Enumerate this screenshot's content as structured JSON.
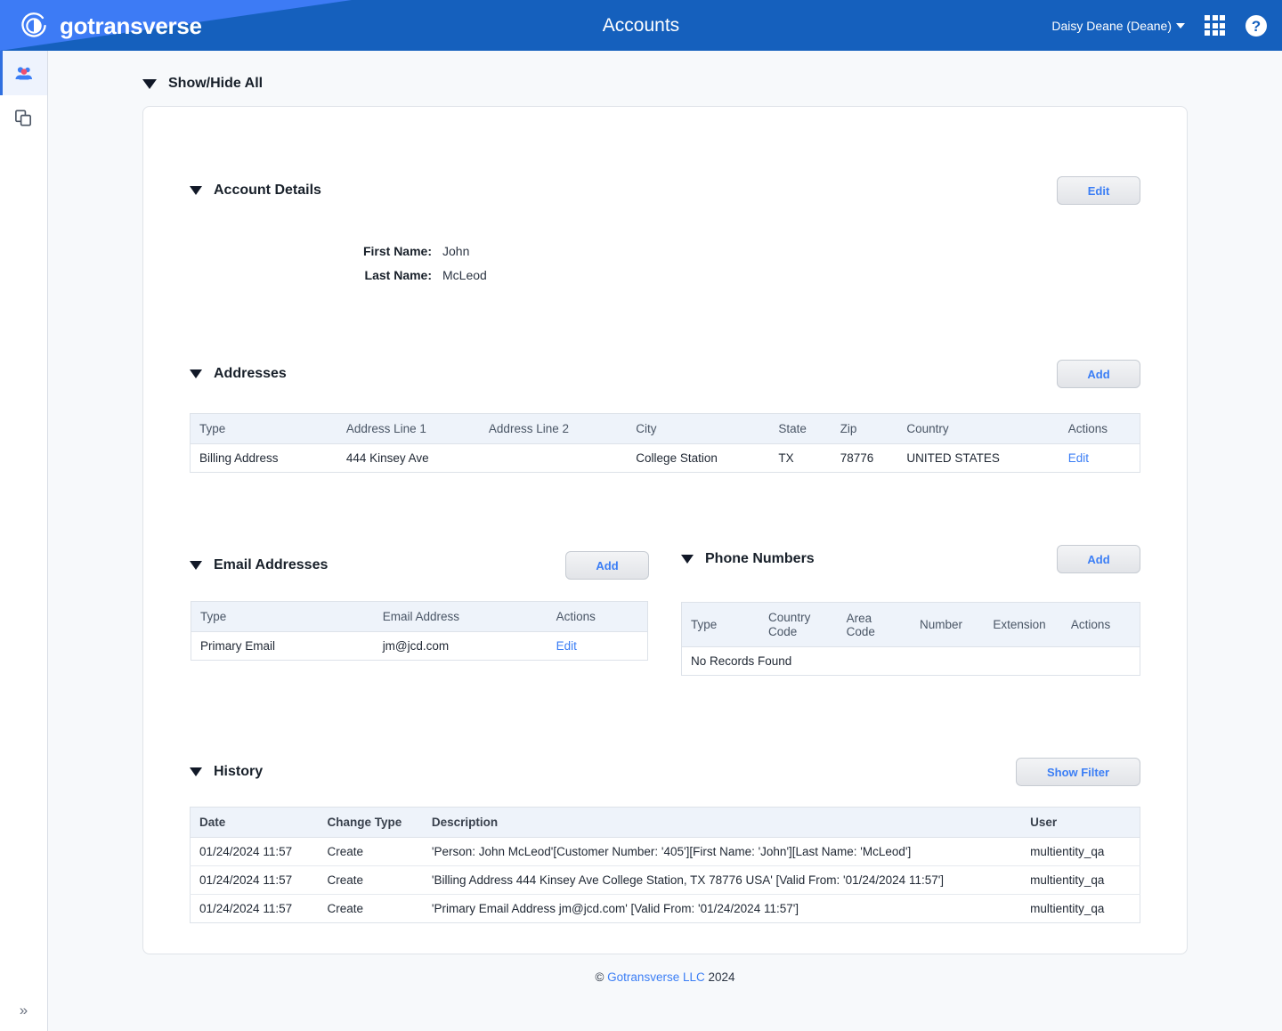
{
  "header": {
    "brand": "gotransverse",
    "title": "Accounts",
    "user": "Daisy Deane (Deane)",
    "apps_icon": "apps-grid-icon",
    "help_icon": "help-circle-icon"
  },
  "sidebar": {
    "items": [
      {
        "name": "accounts",
        "icon": "users-group-icon",
        "active": true
      },
      {
        "name": "documents",
        "icon": "copy-documents-icon",
        "active": false
      }
    ],
    "collapse_label": "»"
  },
  "page": {
    "show_hide_all": "Show/Hide All"
  },
  "account_details": {
    "title": "Account Details",
    "edit_label": "Edit",
    "fields": [
      {
        "label": "First Name:",
        "value": "John"
      },
      {
        "label": "Last Name:",
        "value": "McLeod"
      }
    ]
  },
  "addresses": {
    "title": "Addresses",
    "add_label": "Add",
    "columns": [
      "Type",
      "Address Line 1",
      "Address Line 2",
      "City",
      "State",
      "Zip",
      "Country",
      "Actions"
    ],
    "rows": [
      {
        "type": "Billing Address",
        "line1": "444 Kinsey Ave",
        "line2": "",
        "city": "College Station",
        "state": "TX",
        "zip": "78776",
        "country": "UNITED STATES",
        "action": "Edit"
      }
    ]
  },
  "email_addresses": {
    "title": "Email Addresses",
    "add_label": "Add",
    "columns": [
      "Type",
      "Email Address",
      "Actions"
    ],
    "rows": [
      {
        "type": "Primary Email",
        "email": "jm@jcd.com",
        "action": "Edit"
      }
    ]
  },
  "phone_numbers": {
    "title": "Phone Numbers",
    "add_label": "Add",
    "columns": [
      "Type",
      "Country Code",
      "Area Code",
      "Number",
      "Extension",
      "Actions"
    ],
    "empty_message": "No Records Found",
    "rows": []
  },
  "history": {
    "title": "History",
    "filter_label": "Show Filter",
    "columns": [
      "Date",
      "Change Type",
      "Description",
      "User"
    ],
    "rows": [
      {
        "date": "01/24/2024 11:57",
        "change_type": "Create",
        "description": "'Person: John McLeod'[Customer Number: '405'][First Name: 'John'][Last Name: 'McLeod']",
        "user": "multientity_qa"
      },
      {
        "date": "01/24/2024 11:57",
        "change_type": "Create",
        "description": "'Billing Address 444 Kinsey Ave College Station, TX 78776 USA' [Valid From: '01/24/2024 11:57']",
        "user": "multientity_qa"
      },
      {
        "date": "01/24/2024 11:57",
        "change_type": "Create",
        "description": "'Primary Email Address jm@jcd.com' [Valid From: '01/24/2024 11:57']",
        "user": "multientity_qa"
      }
    ]
  },
  "footer": {
    "copyright_symbol": "©",
    "company": "Gotransverse LLC",
    "year": "2024"
  },
  "colors": {
    "brand_blue": "#1560bd",
    "accent_blue": "#3d7bf5",
    "link_blue": "#3b7ef5",
    "page_bg": "#f7f9fb",
    "table_head_bg": "#eef3fa"
  }
}
